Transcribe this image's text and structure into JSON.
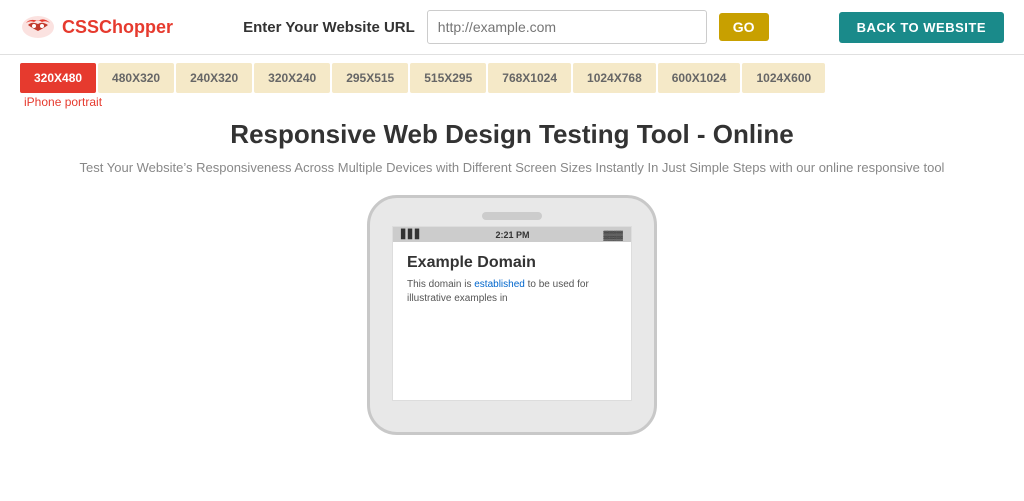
{
  "header": {
    "logo_css": "CSS",
    "logo_chopper": "Chopper",
    "url_label": "Enter Your Website URL",
    "url_placeholder": "http://example.com",
    "go_label": "GO",
    "back_label": "BACK TO WEBSITE"
  },
  "resolutions": [
    {
      "label": "320X480",
      "active": true
    },
    {
      "label": "480X320",
      "active": false
    },
    {
      "label": "240X320",
      "active": false
    },
    {
      "label": "320X240",
      "active": false
    },
    {
      "label": "295X515",
      "active": false
    },
    {
      "label": "515X295",
      "active": false
    },
    {
      "label": "768X1024",
      "active": false
    },
    {
      "label": "1024X768",
      "active": false
    },
    {
      "label": "600X1024",
      "active": false
    },
    {
      "label": "1024X600",
      "active": false
    }
  ],
  "active_resolution_label": "iPhone portrait",
  "main": {
    "title": "Responsive Web Design Testing Tool - Online",
    "subtitle": "Test Your Website’s Responsiveness Across Multiple Devices with Different Screen Sizes Instantly In Just Simple Steps with our online responsive tool"
  },
  "phone": {
    "signal": "▋▋▋",
    "time": "2:21 PM",
    "battery": "▓▓▓",
    "content_title": "Example Domain",
    "content_text": "This domain is established to be used for illustrative examples in"
  }
}
